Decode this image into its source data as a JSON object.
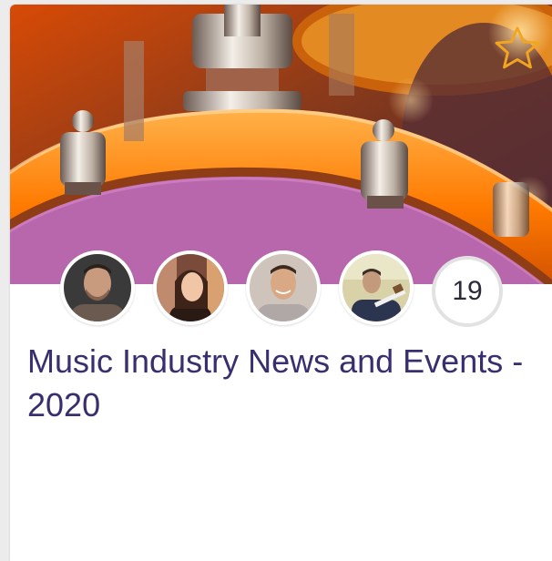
{
  "group_card": {
    "title": "Music Industry News and Events - 2020",
    "favorite_icon": "star-outline-icon",
    "member_count": "19",
    "members": [
      {
        "avatar": "member-avatar-1"
      },
      {
        "avatar": "member-avatar-2"
      },
      {
        "avatar": "member-avatar-3"
      },
      {
        "avatar": "member-avatar-4"
      }
    ],
    "colors": {
      "title": "#3a2f6e",
      "star": "#f2a51f",
      "drum_head": "#b867ad",
      "drum_shell": "#ff7a00"
    }
  }
}
